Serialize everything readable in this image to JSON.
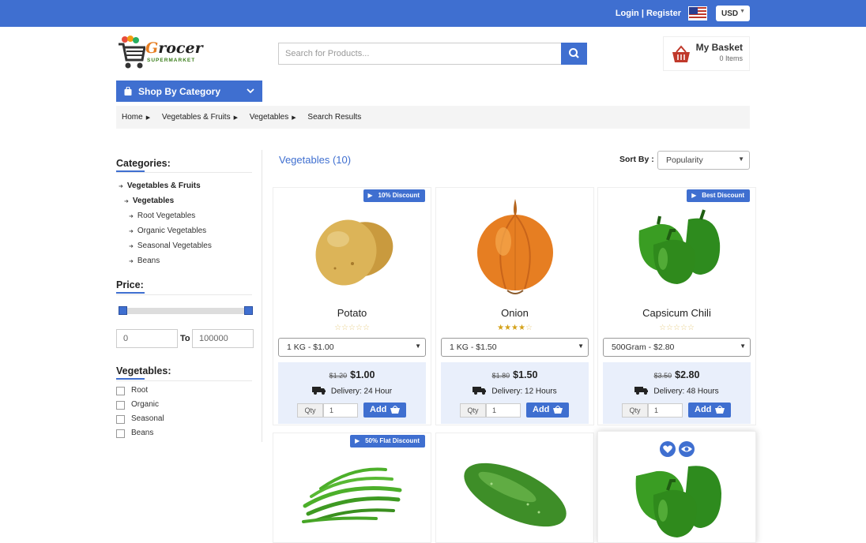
{
  "topbar": {
    "login": "Login",
    "divider": "|",
    "register": "Register",
    "currency": "USD",
    "flag_icon": "us-flag-icon"
  },
  "brand": {
    "word_a": "G",
    "word_b": "rocer",
    "tagline": "SUPERMARKET"
  },
  "search": {
    "placeholder": "Search for Products..."
  },
  "basket": {
    "title": "My Basket",
    "count": "0 Items"
  },
  "shop_category": {
    "label": "Shop By Category"
  },
  "breadcrumb": [
    "Home",
    "Vegetables & Fruits",
    "Vegetables",
    "Search Results"
  ],
  "sidebar": {
    "categories_title": "Categories:",
    "categories": [
      "Vegetables & Fruits",
      "Vegetables",
      "Root Vegetables",
      "Organic Vegetables",
      "Seasonal Vegetables",
      "Beans"
    ],
    "price_title": "Price:",
    "price_min": "0",
    "price_to": "To",
    "price_max": "100000",
    "price_slider": {
      "min_fraction": 0,
      "max_fraction": 1
    },
    "vegetables_title": "Vegetables:",
    "filters": [
      "Root",
      "Organic",
      "Seasonal",
      "Beans"
    ]
  },
  "listing": {
    "title": "Vegetables (10)",
    "sort_label": "Sort By :",
    "sort_value": "Popularity"
  },
  "products": [
    {
      "badge": "10% Discount",
      "name": "Potato",
      "rating": 0,
      "variant": "1 KG - $1.00",
      "old_price": "$1.20",
      "price": "$1.00",
      "delivery": "Delivery: 24 Hour",
      "qty_label": "Qty",
      "qty": "1",
      "add": "Add"
    },
    {
      "badge": "",
      "name": "Onion",
      "rating": 4,
      "variant": "1 KG - $1.50",
      "old_price": "$1.80",
      "price": "$1.50",
      "delivery": "Delivery: 12 Hours",
      "qty_label": "Qty",
      "qty": "1",
      "add": "Add"
    },
    {
      "badge": "Best Discount",
      "name": "Capsicum Chili",
      "rating": 0,
      "variant": "500Gram - $2.80",
      "old_price": "$3.50",
      "price": "$2.80",
      "delivery": "Delivery: 48 Hours",
      "qty_label": "Qty",
      "qty": "1",
      "add": "Add"
    },
    {
      "badge": "50% Flat Discount"
    },
    {
      "badge": ""
    },
    {
      "badge": ""
    }
  ],
  "colors": {
    "primary": "#3f6fd0",
    "star": "#d4a21a",
    "price_box": "#e9effb"
  }
}
